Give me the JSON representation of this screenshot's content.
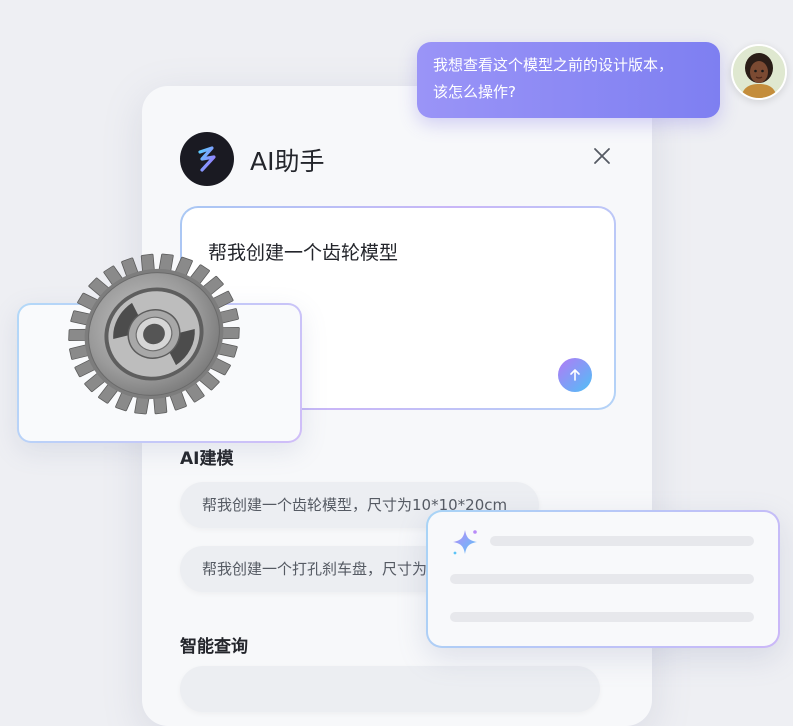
{
  "user_message": {
    "line1": "我想查看这个模型之前的设计版本，",
    "line2": "该怎么操作?"
  },
  "assistant_panel": {
    "title": "AI助手",
    "prompt_text": "帮我创建一个齿轮模型",
    "sections": [
      {
        "title": "AI建模",
        "suggestions": [
          "帮我创建一个齿轮模型，尺寸为10*10*20cm",
          "帮我创建一个打孔刹车盘，尺寸为10*10*20cm"
        ]
      },
      {
        "title": "智能查询"
      }
    ]
  },
  "icons": {
    "logo": "ai-assistant-logo-icon",
    "close": "close-icon",
    "send": "send-arrow-icon",
    "sparkle": "sparkle-icon",
    "gear": "gear-model-icon",
    "avatar": "user-avatar"
  },
  "colors": {
    "bubble": "#8b88f4",
    "send_gradient_start": "#b27af6",
    "send_gradient_end": "#4fc0f6"
  }
}
